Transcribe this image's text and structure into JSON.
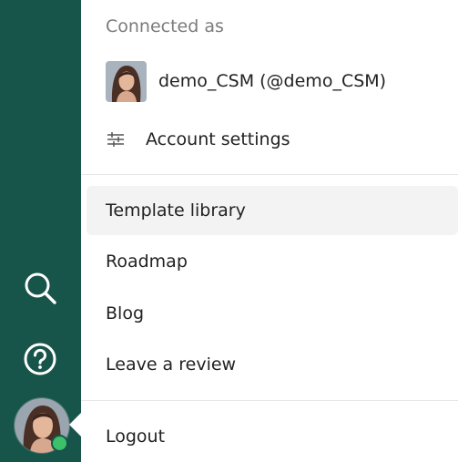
{
  "sidebar": {
    "search_icon": "search-icon",
    "help_icon": "help-circle-icon",
    "status_color": "#3cc06a",
    "background_color": "#17544a"
  },
  "menu": {
    "section_label": "Connected as",
    "user": {
      "display": "demo_CSM (@demo_CSM)"
    },
    "account_settings_label": "Account settings",
    "items": [
      {
        "label": "Template library",
        "active": true
      },
      {
        "label": "Roadmap",
        "active": false
      },
      {
        "label": "Blog",
        "active": false
      },
      {
        "label": "Leave a review",
        "active": false
      }
    ],
    "logout_label": "Logout"
  }
}
